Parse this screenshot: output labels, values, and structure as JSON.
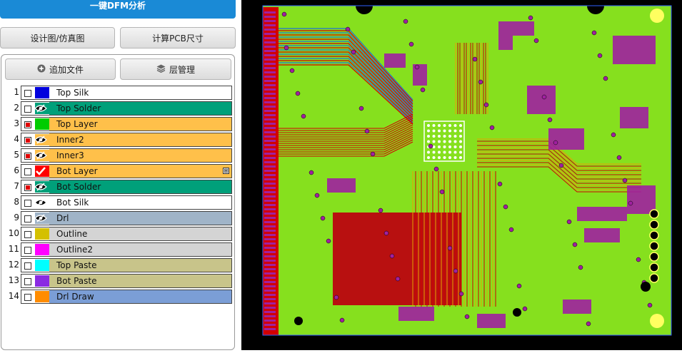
{
  "header": {
    "dfm_button": "一键DFM分析"
  },
  "toolbar": {
    "design_view_button": "设计图/仿真图",
    "calc_size_button": "计算PCB尺寸",
    "add_file_button": "追加文件",
    "layer_manage_button": "层管理"
  },
  "layers": [
    {
      "index": "1",
      "name": "Top Silk",
      "checked": false,
      "eye": "none",
      "swatch": "#0000dd",
      "row_bg": "#ffffff"
    },
    {
      "index": "2",
      "name": "Top Solder",
      "checked": false,
      "eye": "hidden",
      "swatch": "#00a07a",
      "row_bg": "#00a07a"
    },
    {
      "index": "3",
      "name": "Top Layer",
      "checked": true,
      "eye": "none",
      "swatch": "#00cc00",
      "row_bg": "#ffc04a"
    },
    {
      "index": "4",
      "name": "Inner2",
      "checked": true,
      "eye": "hidden",
      "swatch": "#ffc04a",
      "row_bg": "#ffc04a"
    },
    {
      "index": "5",
      "name": "Inner3",
      "checked": true,
      "eye": "hidden",
      "swatch": "#ffc04a",
      "row_bg": "#ffc04a"
    },
    {
      "index": "6",
      "name": "Bot Layer",
      "checked": false,
      "eye": "check",
      "swatch": "#ff0000",
      "row_bg": "#ffc04a",
      "expand": "⊞"
    },
    {
      "index": "7",
      "name": "Bot Solder",
      "checked": true,
      "eye": "hidden",
      "swatch": "#00a07a",
      "row_bg": "#00a07a"
    },
    {
      "index": "8",
      "name": "Bot Silk",
      "checked": false,
      "eye": "hidden",
      "swatch": "#ffffff",
      "row_bg": "#ffffff"
    },
    {
      "index": "9",
      "name": "Drl",
      "checked": false,
      "eye": "hidden",
      "swatch": "#a0b4c8",
      "row_bg": "#a0b4c8"
    },
    {
      "index": "10",
      "name": "Outline",
      "checked": false,
      "eye": "none",
      "swatch": "#d4c000",
      "row_bg": "#d4d4d4"
    },
    {
      "index": "11",
      "name": "Outline2",
      "checked": false,
      "eye": "none",
      "swatch": "#ff00ff",
      "row_bg": "#d4d4d4"
    },
    {
      "index": "12",
      "name": "Top Paste",
      "checked": false,
      "eye": "none",
      "swatch": "#00ffff",
      "row_bg": "#c8c48a"
    },
    {
      "index": "13",
      "name": "Bot Paste",
      "checked": false,
      "eye": "none",
      "swatch": "#8a2be2",
      "row_bg": "#c8c48a"
    },
    {
      "index": "14",
      "name": "Drl Draw",
      "checked": false,
      "eye": "none",
      "swatch": "#ff8c00",
      "row_bg": "#7b9ed6"
    }
  ],
  "pcb": {
    "background": "#000000",
    "board_color": "#86e01e",
    "trace_color": "#d20000",
    "via_color": "#a020a0",
    "silk_color": "#ffff60"
  }
}
